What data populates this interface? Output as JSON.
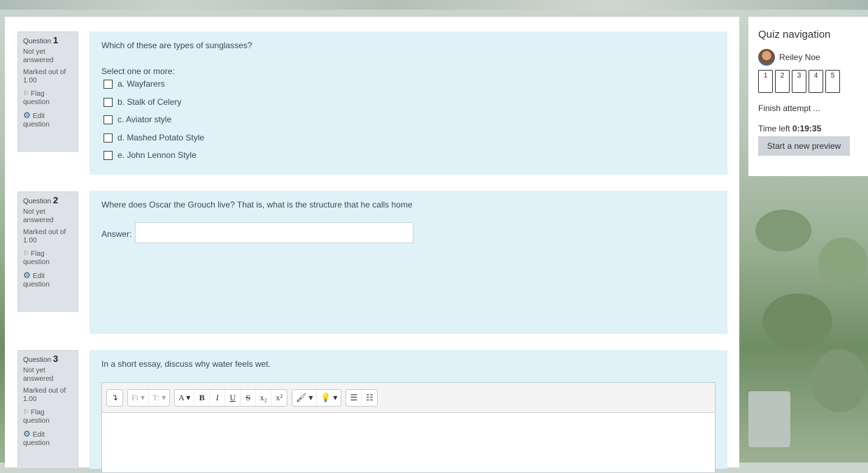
{
  "questions": [
    {
      "label": "Question",
      "number": "1",
      "state": "Not yet answered",
      "marks": "Marked out of 1.00",
      "flag": "Flag question",
      "edit": "Edit question",
      "text": "Which of these are types of sunglasses?",
      "prompt": "Select one or more:",
      "options": [
        "a. Wayfarers",
        "b. Stalk of Celery",
        "c. Aviator style",
        "d. Mashed Potato Style",
        "e. John Lennon Style"
      ]
    },
    {
      "label": "Question",
      "number": "2",
      "state": "Not yet answered",
      "marks": "Marked out of 1.00",
      "flag": "Flag question",
      "edit": "Edit question",
      "text": "Where does Oscar the Grouch live? That is, what is the structure that he calls home",
      "answer_label": "Answer:",
      "answer_value": ""
    },
    {
      "label": "Question",
      "number": "3",
      "state": "Not yet answered",
      "marks": "Marked out of 1.00",
      "flag": "Flag question",
      "edit": "Edit question",
      "text": "In a short essay, discuss why water feels wet.",
      "toolbar": {
        "expand": "↴",
        "font_family": "Fi ▾",
        "font_size": "T: ▾",
        "font_color": "A ▾",
        "bold": "B",
        "italic": "I",
        "underline": "U",
        "strike": "S",
        "subscript": "x₂",
        "superscript": "x²",
        "brush": "🖌 ▾",
        "bulb": "💡 ▾",
        "bullets": "☰",
        "numbered": "☷"
      }
    }
  ],
  "nav": {
    "title": "Quiz navigation",
    "user": "Reiley Noe",
    "buttons": [
      "1",
      "2",
      "3",
      "4",
      "5"
    ],
    "finish": "Finish attempt ...",
    "time_label": "Time left",
    "time_value": "0:19:35",
    "preview_button": "Start a new preview"
  },
  "colors": {
    "question_bg": "#e0f1f7",
    "info_bg": "#dee2e6",
    "edit_icon": "#1d5b8a"
  },
  "icons": [
    "flag-icon",
    "gear-icon",
    "checkbox-icon",
    "avatar"
  ]
}
